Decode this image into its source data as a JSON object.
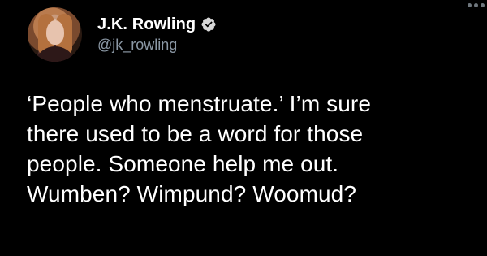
{
  "tweet": {
    "author": {
      "display_name": "J.K. Rowling",
      "handle": "@jk_rowling",
      "verified": true,
      "avatar_icon": "author-avatar"
    },
    "text": "‘People who menstruate.’ I’m sure\nthere used to be a word for those\npeople. Someone help me out.\nWumben? Wimpund? Woomud?"
  },
  "colors": {
    "background": "#000000",
    "text": "#ffffff",
    "secondary_text": "#8b98a5",
    "verified_badge": "#d8d8d8"
  },
  "icons": [
    "verified-badge-icon",
    "more-options-icon"
  ]
}
